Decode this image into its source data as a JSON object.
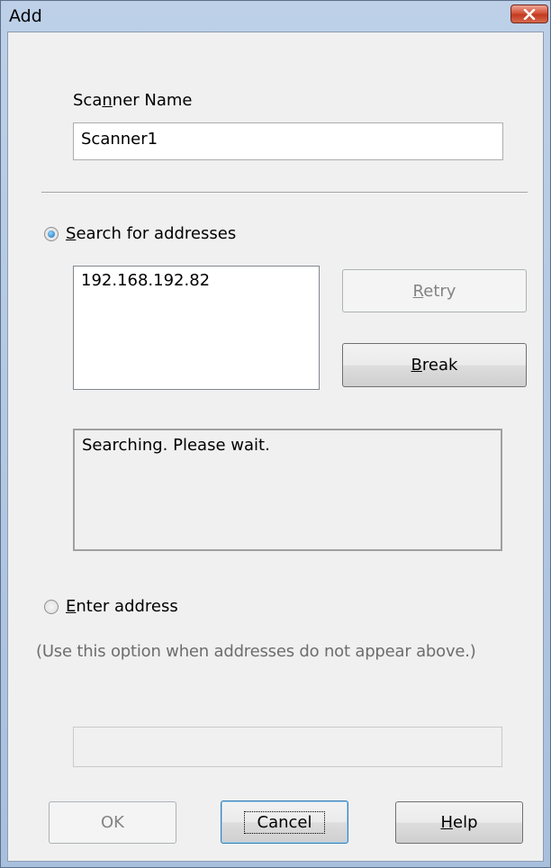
{
  "window": {
    "title": "Add"
  },
  "scanner_name": {
    "label_pre": "Sca",
    "label_mn": "n",
    "label_post": "ner Name",
    "value": "Scanner1"
  },
  "search": {
    "radio_mn": "S",
    "radio_rest": "earch for addresses",
    "selected": true,
    "found_addresses": [
      "192.168.192.82"
    ],
    "retry_mn": "R",
    "retry_rest": "etry",
    "break_mn": "B",
    "break_rest": "reak",
    "status": "Searching. Please wait."
  },
  "enter": {
    "radio_mn": "E",
    "radio_rest": "nter address",
    "selected": false,
    "hint": "(Use this option when addresses do not appear above.)",
    "value": ""
  },
  "buttons": {
    "ok": "OK",
    "cancel": "Cancel",
    "help_mn": "H",
    "help_rest": "elp"
  },
  "colors": {
    "close_button": "#c33a20",
    "radio_selected": "#1a6fb5"
  }
}
